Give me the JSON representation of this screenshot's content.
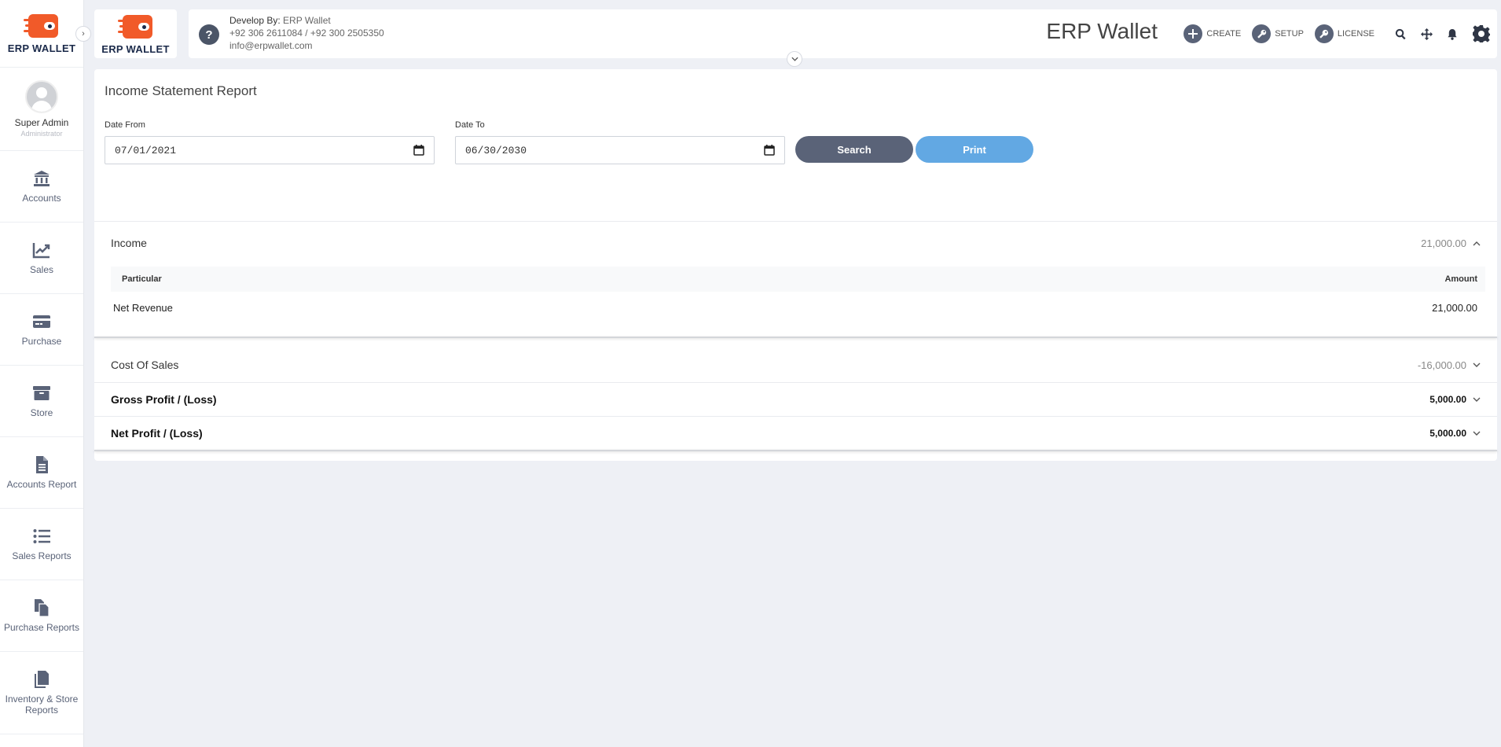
{
  "brand": {
    "name": "ERP WALLET",
    "accent": "#f15a29",
    "navy": "#1b2a4a"
  },
  "user": {
    "name": "Super Admin",
    "role": "Administrator"
  },
  "sidebar": {
    "items": [
      {
        "label": "Accounts",
        "icon": "bank-icon"
      },
      {
        "label": "Sales",
        "icon": "trend-chart-icon"
      },
      {
        "label": "Purchase",
        "icon": "credit-card-icon"
      },
      {
        "label": "Store",
        "icon": "archive-box-icon"
      },
      {
        "label": "Accounts Report",
        "icon": "document-icon"
      },
      {
        "label": "Sales Reports",
        "icon": "list-icon"
      },
      {
        "label": "Purchase Reports",
        "icon": "copy-documents-icon"
      },
      {
        "label": "Inventory & Store Reports",
        "icon": "documents-icon"
      }
    ]
  },
  "header": {
    "dev_prefix": "Develop By:",
    "dev_name": "ERP Wallet",
    "phone1": "+92 306 2611084",
    "phone_sep": "/",
    "phone2": "+92 300 2505350",
    "email": "info@erpwallet.com",
    "app_title": "ERP Wallet",
    "actions": {
      "create": "CREATE",
      "setup": "SETUP",
      "license": "LICENSE"
    }
  },
  "report": {
    "title": "Income Statement Report",
    "date_from_label": "Date From",
    "date_from_value": "07/01/2021",
    "date_to_label": "Date To",
    "date_to_value": "06/30/2030",
    "search_label": "Search",
    "print_label": "Print",
    "income": {
      "label": "Income",
      "total": "21,000.00",
      "columns": {
        "particular": "Particular",
        "amount": "Amount"
      },
      "rows": [
        {
          "particular": "Net Revenue",
          "amount": "21,000.00"
        }
      ]
    },
    "cost_of_sales": {
      "label": "Cost Of Sales",
      "total": "-16,000.00"
    },
    "gross_profit": {
      "label": "Gross Profit / (Loss)",
      "total": "5,000.00"
    },
    "net_profit": {
      "label": "Net Profit / (Loss)",
      "total": "5,000.00"
    }
  },
  "colors": {
    "sidebar_icon": "#5a6378",
    "search_button": "#5a6378",
    "print_button": "#62a8e3",
    "background": "#eef0f5"
  }
}
